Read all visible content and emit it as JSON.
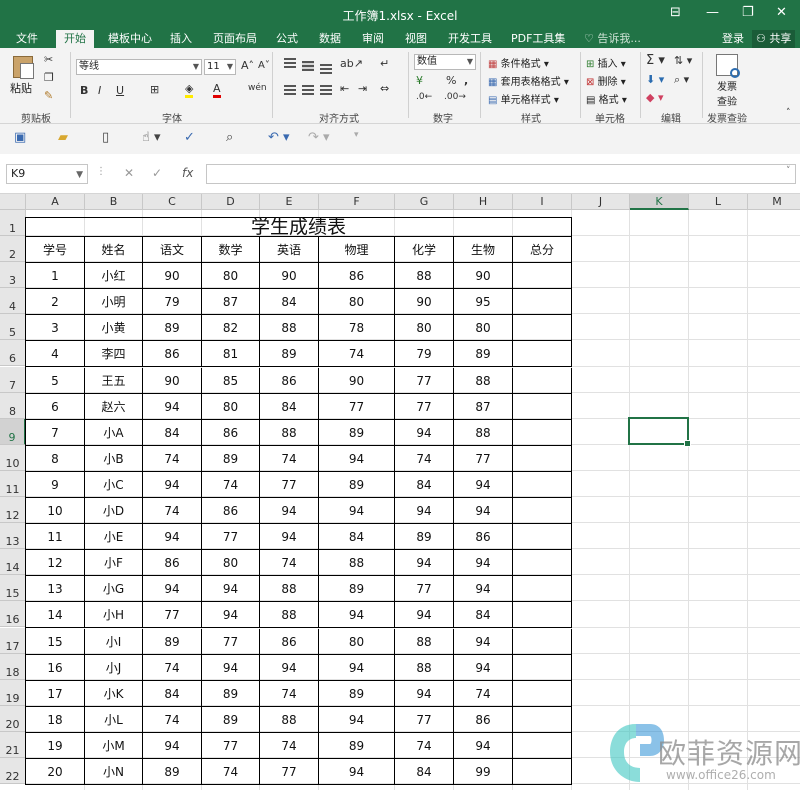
{
  "window": {
    "title": "工作簿1.xlsx - Excel",
    "controls": [
      "⊟",
      "—",
      "❐",
      "✕"
    ]
  },
  "ribbon_tabs": [
    "文件",
    "开始",
    "模板中心",
    "插入",
    "页面布局",
    "公式",
    "数据",
    "审阅",
    "视图",
    "开发工具",
    "PDF工具集"
  ],
  "active_tab": "开始",
  "tell_me": "告诉我...",
  "login": "登录",
  "share": "共享",
  "ribbon": {
    "clipboard": {
      "label": "剪贴板",
      "paste": "粘贴"
    },
    "font": {
      "label": "字体",
      "font_name": "等线",
      "font_size": "11"
    },
    "alignment": {
      "label": "对齐方式"
    },
    "number": {
      "label": "数字",
      "format": "数值"
    },
    "styles": {
      "label": "样式",
      "conditional": "条件格式",
      "table_format": "套用表格格式",
      "cell_style": "单元格样式"
    },
    "cells": {
      "label": "单元格",
      "insert": "插入",
      "delete": "删除",
      "format": "格式"
    },
    "editing": {
      "label": "编辑"
    },
    "invoice": {
      "label": "发票查验",
      "button_line1": "发票",
      "button_line2": "查验"
    }
  },
  "formula_bar": {
    "name_box": "K9",
    "value": ""
  },
  "columns": [
    "A",
    "B",
    "C",
    "D",
    "E",
    "F",
    "G",
    "H",
    "I",
    "J",
    "K",
    "L",
    "M"
  ],
  "selected_column": "K",
  "selected_row": "9",
  "rows": [
    "1",
    "2",
    "3",
    "4",
    "5",
    "6",
    "7",
    "8",
    "9",
    "10",
    "11",
    "12",
    "13",
    "14",
    "15",
    "16",
    "17",
    "18",
    "19",
    "20",
    "21",
    "22"
  ],
  "sheet": {
    "title": "学生成绩表",
    "headers": [
      "学号",
      "姓名",
      "语文",
      "数学",
      "英语",
      "物理",
      "化学",
      "生物",
      "总分"
    ],
    "records": [
      [
        "1",
        "小红",
        "90",
        "80",
        "90",
        "86",
        "88",
        "90",
        ""
      ],
      [
        "2",
        "小明",
        "79",
        "87",
        "84",
        "80",
        "90",
        "95",
        ""
      ],
      [
        "3",
        "小黄",
        "89",
        "82",
        "88",
        "78",
        "80",
        "80",
        ""
      ],
      [
        "4",
        "李四",
        "86",
        "81",
        "89",
        "74",
        "79",
        "89",
        ""
      ],
      [
        "5",
        "王五",
        "90",
        "85",
        "86",
        "90",
        "77",
        "88",
        ""
      ],
      [
        "6",
        "赵六",
        "94",
        "80",
        "84",
        "77",
        "77",
        "87",
        ""
      ],
      [
        "7",
        "小A",
        "84",
        "86",
        "88",
        "89",
        "94",
        "88",
        ""
      ],
      [
        "8",
        "小B",
        "74",
        "89",
        "74",
        "94",
        "74",
        "77",
        ""
      ],
      [
        "9",
        "小C",
        "94",
        "74",
        "77",
        "89",
        "84",
        "94",
        ""
      ],
      [
        "10",
        "小D",
        "74",
        "86",
        "94",
        "94",
        "94",
        "94",
        ""
      ],
      [
        "11",
        "小E",
        "94",
        "77",
        "94",
        "84",
        "89",
        "86",
        ""
      ],
      [
        "12",
        "小F",
        "86",
        "80",
        "74",
        "88",
        "94",
        "94",
        ""
      ],
      [
        "13",
        "小G",
        "94",
        "94",
        "88",
        "89",
        "77",
        "94",
        ""
      ],
      [
        "14",
        "小H",
        "77",
        "94",
        "88",
        "94",
        "94",
        "84",
        ""
      ],
      [
        "15",
        "小I",
        "89",
        "77",
        "86",
        "80",
        "88",
        "94",
        ""
      ],
      [
        "16",
        "小J",
        "74",
        "94",
        "94",
        "94",
        "88",
        "94",
        ""
      ],
      [
        "17",
        "小K",
        "84",
        "89",
        "74",
        "89",
        "94",
        "74",
        ""
      ],
      [
        "18",
        "小L",
        "74",
        "89",
        "88",
        "94",
        "77",
        "86",
        ""
      ],
      [
        "19",
        "小M",
        "94",
        "77",
        "74",
        "89",
        "74",
        "94",
        ""
      ],
      [
        "20",
        "小N",
        "89",
        "74",
        "77",
        "94",
        "84",
        "99",
        ""
      ]
    ]
  },
  "watermark": {
    "text": "欧菲资源网",
    "url": "www.office26.com"
  },
  "colors": {
    "accent": "#217346",
    "logo_teal": "#3ec7c2",
    "logo_blue": "#2b8fd6",
    "watermark_text": "#8a8a8a"
  }
}
